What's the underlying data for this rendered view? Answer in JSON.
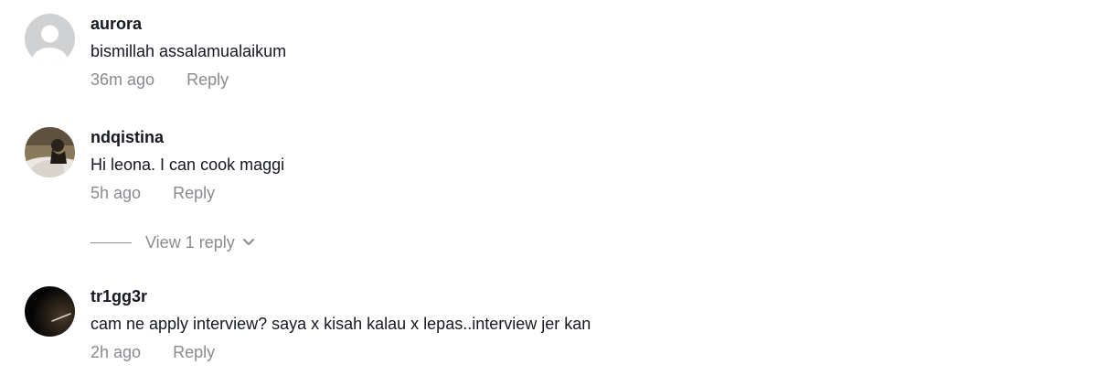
{
  "comments": [
    {
      "username": "aurora",
      "text": "bismillah assalamualaikum",
      "time": "36m ago",
      "reply_label": "Reply",
      "avatar_icon": "default-user-avatar"
    },
    {
      "username": "ndqistina",
      "text": "Hi leona. I can cook maggi",
      "time": "5h ago",
      "reply_label": "Reply",
      "avatar_icon": "profile-photo"
    },
    {
      "username": "tr1gg3r",
      "text": "cam ne apply interview? saya x kisah kalau x lepas..interview jer kan",
      "time": "2h ago",
      "reply_label": "Reply",
      "avatar_icon": "profile-photo-dark"
    }
  ],
  "view_replies": {
    "label": "View 1 reply",
    "icon": "chevron-down-icon"
  },
  "colors": {
    "username": "#161823",
    "meta": "#8a8b91",
    "default_avatar_bg": "#d0d1d3"
  }
}
